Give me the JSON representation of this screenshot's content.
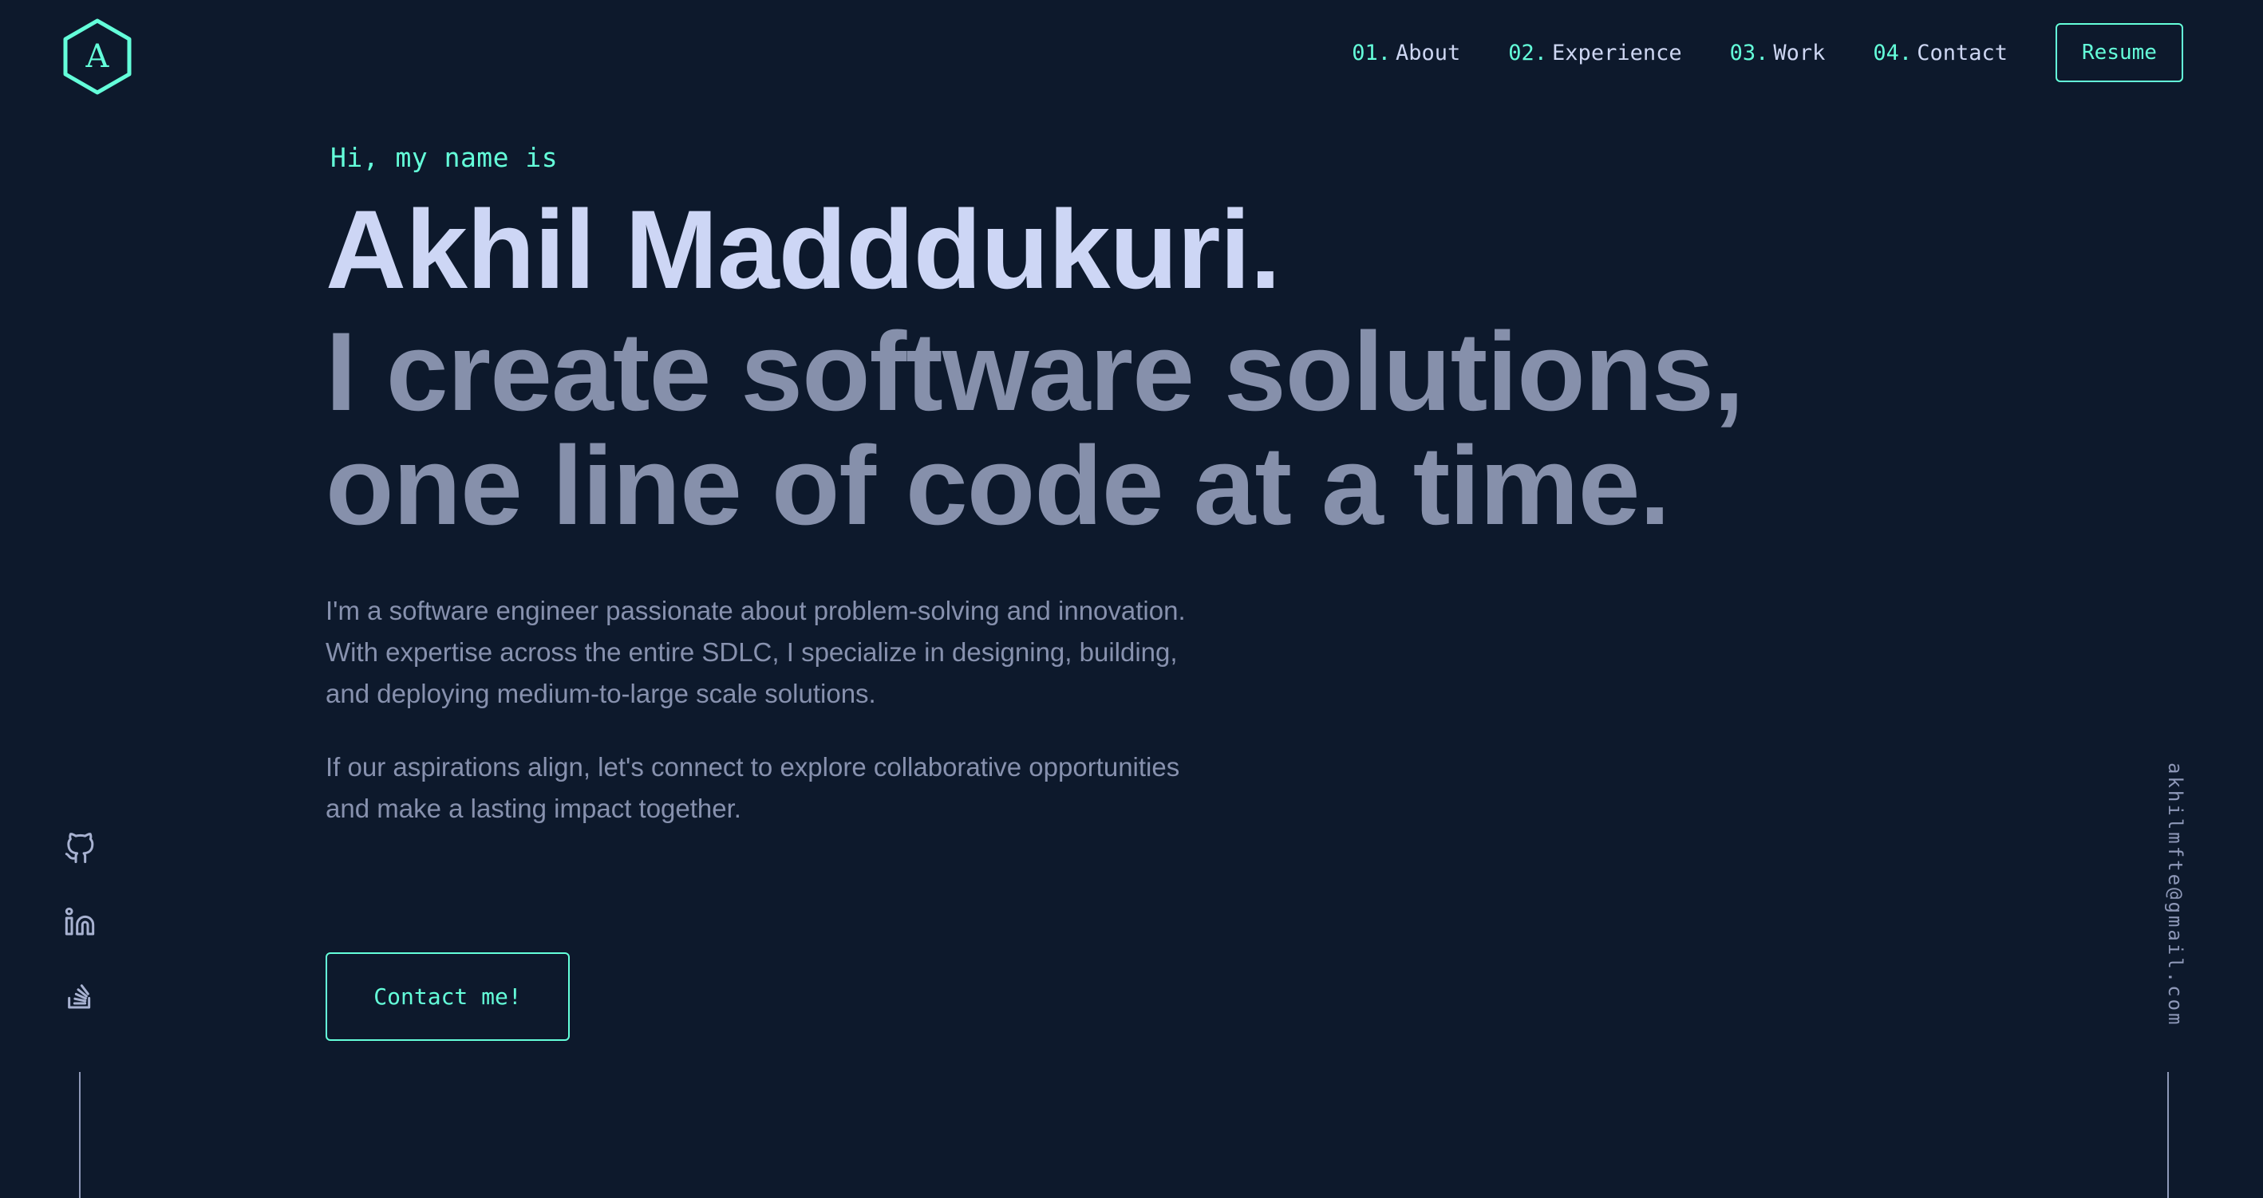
{
  "header": {
    "logo_letter": "A",
    "nav": [
      {
        "num": "01.",
        "label": "About"
      },
      {
        "num": "02.",
        "label": "Experience"
      },
      {
        "num": "03.",
        "label": "Work"
      },
      {
        "num": "04.",
        "label": "Contact"
      }
    ],
    "resume_label": "Resume"
  },
  "hero": {
    "greeting": "Hi, my name is",
    "name": "Akhil Madddukuri.",
    "tagline_line1": "I create software solutions,",
    "tagline_line2": "one line of code at a time.",
    "bio_paragraph1": "I'm a software engineer passionate about problem-solving and innovation. With expertise across the entire SDLC, I specialize in designing, building, and deploying medium-to-large scale solutions.",
    "bio_paragraph2": "If our aspirations align, let's connect to explore collaborative opportunities and make a lasting impact together.",
    "cta_label": "Contact me!"
  },
  "socials": [
    {
      "icon": "github-icon"
    },
    {
      "icon": "linkedin-icon"
    },
    {
      "icon": "stackoverflow-icon"
    }
  ],
  "email": "akhilmfte@gmail.com",
  "colors": {
    "background": "#0d192c",
    "accent": "#64ffda",
    "heading": "#cdd6f5",
    "muted": "#8690ab"
  }
}
